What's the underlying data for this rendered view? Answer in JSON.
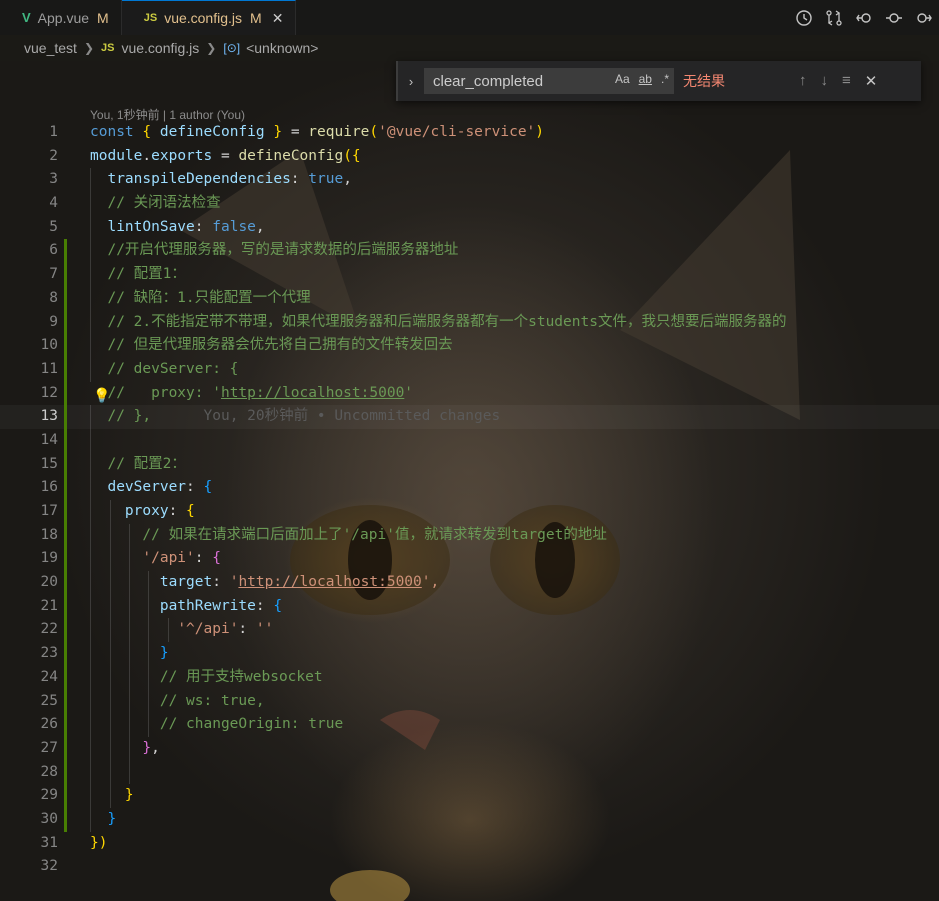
{
  "tabs": [
    {
      "icon": "V",
      "name": "App.vue",
      "status": "M"
    },
    {
      "icon": "JS",
      "name": "vue.config.js",
      "status": "M",
      "close": "✕"
    }
  ],
  "breadcrumb": {
    "folder": "vue_test",
    "file_icon": "JS",
    "file": "vue.config.js",
    "symbol": "<unknown>"
  },
  "find": {
    "query": "clear_completed",
    "opt_case": "Aa",
    "opt_word": "ab",
    "opt_regex": ".*",
    "result": "无结果"
  },
  "blame_header": "You, 1秒钟前 | 1 author (You)",
  "inline_blame": "You, 20秒钟前 • Uncommitted changes",
  "code": {
    "l1": [
      "const",
      "{",
      "defineConfig",
      "}",
      "=",
      "require",
      "(",
      "'@vue/cli-service'",
      ")"
    ],
    "l2": [
      "module",
      "exports",
      "defineConfig",
      "({"
    ],
    "l3": [
      "transpileDependencies",
      ":",
      "true",
      ","
    ],
    "l4": "// 关闭语法检查",
    "l5": [
      "lintOnSave",
      ":",
      "false",
      ","
    ],
    "l6": "//开启代理服务器，写的是请求数据的后端服务器地址",
    "l7": "// 配置1：",
    "l8": "// 缺陷：1.只能配置一个代理",
    "l9": "// 2.不能指定带不带理，如果代理服务器和后端服务器都有一个students文件，我只想要后端服务器的",
    "l10": "// 但是代理服务器会优先将自己拥有的文件转发回去",
    "l11": "// devServer: {",
    "l12a": "//   proxy: '",
    "l12b": "http://localhost:5000",
    "l12c": "'",
    "l13": "// },",
    "l15": "// 配置2：",
    "l16": [
      "devServer",
      ":",
      "{"
    ],
    "l17": [
      "proxy",
      ":",
      "{"
    ],
    "l18": "// 如果在请求端口后面加上了'/api'值，就请求转发到target的地址",
    "l19": [
      "'/api'",
      ":",
      "{"
    ],
    "l20": [
      "target",
      ":",
      "'",
      "http://localhost:5000",
      "',"
    ],
    "l21": [
      "pathRewrite",
      ":",
      "{"
    ],
    "l22": [
      "'^/api'",
      ":",
      "''"
    ],
    "l23": "}",
    "l24": "// 用于支持websocket",
    "l25": "// ws: true,",
    "l26": "// changeOrigin: true",
    "l27": [
      "}",
      ","
    ],
    "l29": "}",
    "l30": "}",
    "l31": "})"
  },
  "line_numbers": [
    "1",
    "2",
    "3",
    "4",
    "5",
    "6",
    "7",
    "8",
    "9",
    "10",
    "11",
    "12",
    "13",
    "14",
    "15",
    "16",
    "17",
    "18",
    "19",
    "20",
    "21",
    "22",
    "23",
    "24",
    "25",
    "26",
    "27",
    "28",
    "29",
    "30",
    "31",
    "32"
  ]
}
